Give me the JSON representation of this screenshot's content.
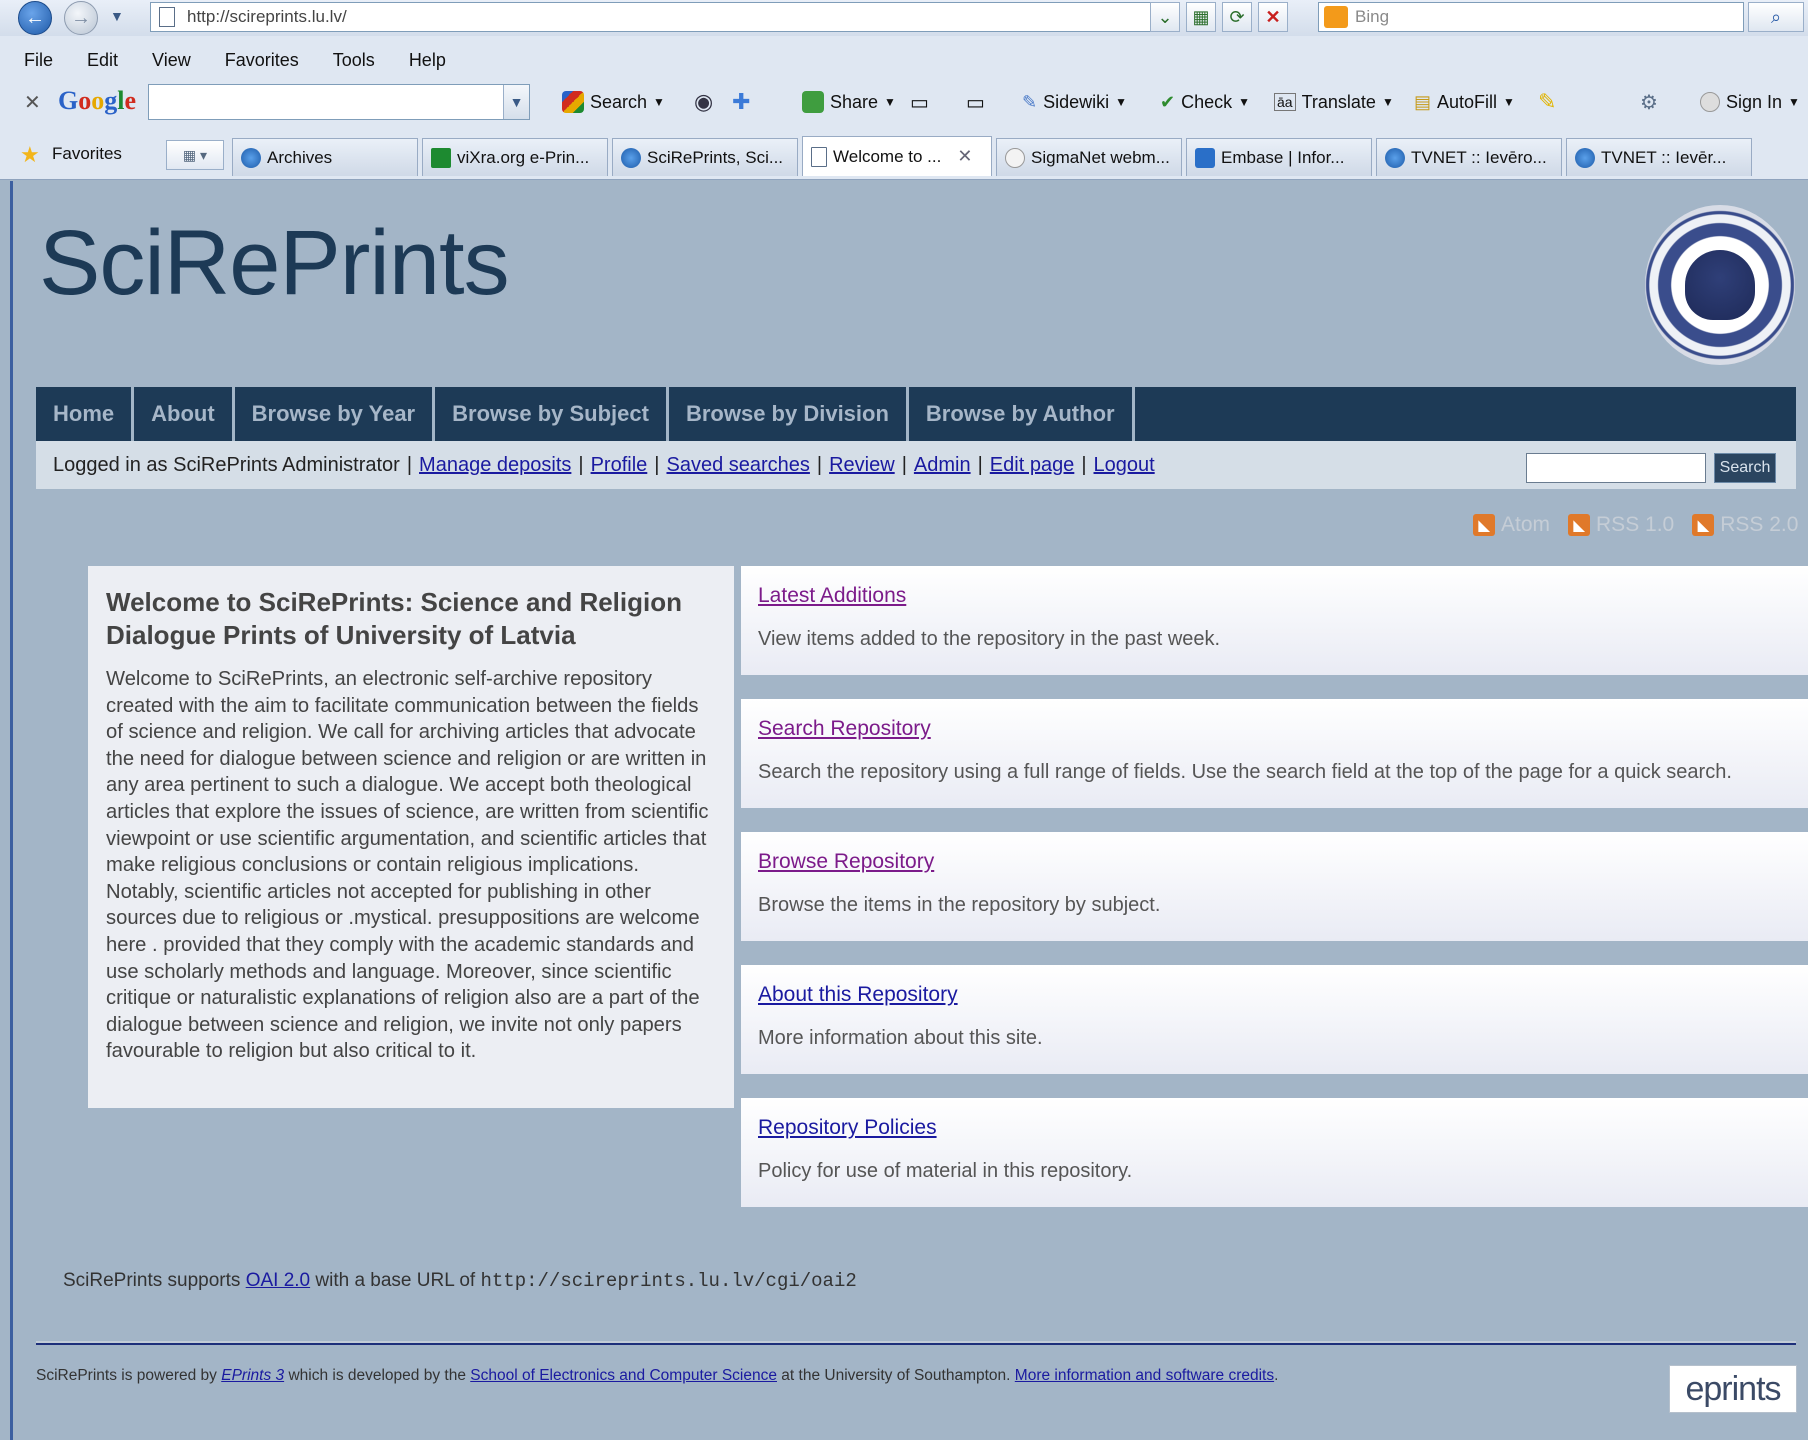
{
  "browser": {
    "url": "http://scireprints.lu.lv/",
    "bing_placeholder": "Bing",
    "menu": [
      "File",
      "Edit",
      "View",
      "Favorites",
      "Tools",
      "Help"
    ],
    "google_toolbar": {
      "search_label": "Search",
      "share_label": "Share",
      "sidewiki_label": "Sidewiki",
      "check_label": "Check",
      "translate_label": "Translate",
      "autofill_label": "AutoFill",
      "signin_label": "Sign In"
    },
    "favorites_label": "Favorites",
    "tabs": [
      {
        "label": "Archives"
      },
      {
        "label": "viXra.org e-Prin..."
      },
      {
        "label": "SciRePrints, Sci..."
      },
      {
        "label": "Welcome to ..."
      },
      {
        "label": "SigmaNet webm..."
      },
      {
        "label": "Embase | Infor..."
      },
      {
        "label": "TVNET :: Ievēro..."
      },
      {
        "label": "TVNET :: Ievēr..."
      }
    ]
  },
  "site": {
    "title": "SciRePrints",
    "nav": [
      "Home",
      "About",
      "Browse by Year",
      "Browse by Subject",
      "Browse by Division",
      "Browse by Author"
    ],
    "login": {
      "prefix": "Logged in as SciRePrints Administrator",
      "links": [
        "Manage deposits",
        "Profile",
        "Saved searches",
        "Review",
        "Admin",
        "Edit page",
        "Logout"
      ]
    },
    "search_button": "Search",
    "feeds": [
      "Atom",
      "RSS 1.0",
      "RSS 2.0"
    ],
    "welcome": {
      "title": "Welcome to SciRePrints: Science and Religion Dialogue Prints of University of Latvia",
      "body": "Welcome to SciRePrints, an electronic self-archive repository created with the aim to facilitate communication between the fields of science and religion. We call for archiving articles that advocate the need for dialogue between science and religion or are written in any area pertinent to such a dialogue. We accept both theological articles that explore the issues of science, are written from scientific viewpoint or use scientific argumentation, and scientific articles that make religious conclusions or contain religious implications. Notably, scientific articles not accepted for publishing in other sources due to religious or .mystical. presuppositions are welcome here . provided that they comply with the academic standards and use scholarly methods and language. Moreover, since scientific critique or naturalistic explanations of religion also are a part of the dialogue between science and religion, we invite not only papers favourable to religion but also critical to it."
    },
    "cards": [
      {
        "link": "Latest Additions",
        "desc": "View items added to the repository in the past week."
      },
      {
        "link": "Search Repository",
        "desc": "Search the repository using a full range of fields. Use the search field at the top of the page for a quick search."
      },
      {
        "link": "Browse Repository",
        "desc": "Browse the items in the repository by subject."
      },
      {
        "link": "About this Repository",
        "desc": "More information about this site."
      },
      {
        "link": "Repository Policies",
        "desc": "Policy for use of material in this repository."
      }
    ],
    "oai": {
      "prefix": "SciRePrints supports",
      "link": "OAI 2.0",
      "middle": "with a base URL of",
      "url": "http://scireprints.lu.lv/cgi/oai2"
    },
    "footer": {
      "t1": "SciRePrints is powered by",
      "l1": "EPrints 3",
      "t2": "which is developed by the",
      "l2": "School of Electronics and Computer Science",
      "t3": "at the University of Southampton.",
      "l3": "More information and software credits",
      "t4": "."
    },
    "eprints_logo": "eprints"
  }
}
